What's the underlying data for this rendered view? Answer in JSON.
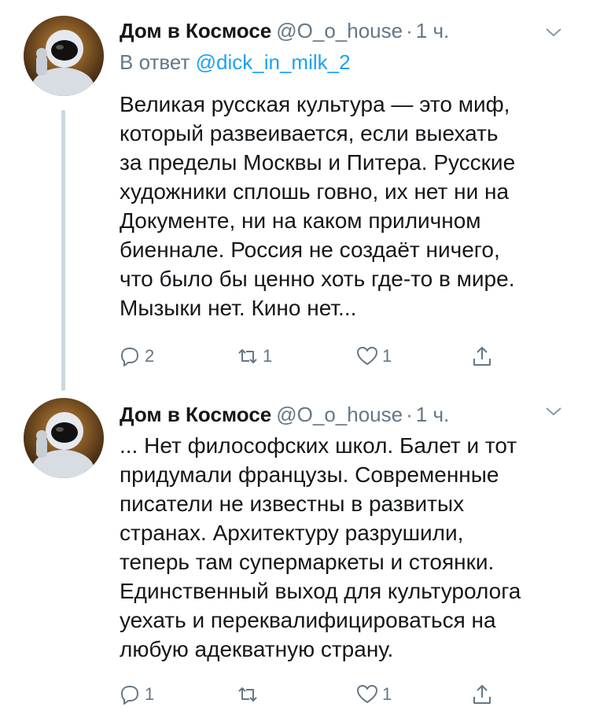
{
  "tweets": [
    {
      "author_name": "Дом в Космосе",
      "handle": "@O_o_house",
      "separator": "·",
      "time": "1 ч.",
      "reply_prefix": "В ответ",
      "reply_to": "@dick_in_milk_2",
      "text": "Великая русская культура — это миф,\nкоторый развеивается, если выехать\nза пределы Москвы и Питера. Русские\nхудожники сплошь говно, их нет ни на\nДокументе, ни на каком приличном\nбиеннале. Россия не создаёт ничего,\nчто было бы ценно хоть где-то в мире.\nМызыки нет. Кино нет...",
      "actions": {
        "replies": "2",
        "retweets": "1",
        "likes": "1"
      }
    },
    {
      "author_name": "Дом в Космосе",
      "handle": "@O_o_house",
      "separator": "·",
      "time": "1 ч.",
      "text": "... Нет философских школ. Балет и тот\nпридумали французы. Современные\nписатели не известны в развитых\nстранах. Архитектуру разрушили,\nтеперь там супермаркеты и стоянки.\nЕдинственный выход для культуролога\nуехать и переквалифицироваться на\nлюбую адекватную страну.",
      "actions": {
        "replies": "1",
        "retweets": "",
        "likes": "1"
      }
    }
  ],
  "icons": {
    "reply": "reply-icon",
    "retweet": "retweet-icon",
    "like": "heart-icon",
    "share": "share-icon",
    "menu": "chevron-down-icon"
  },
  "colors": {
    "text": "#14171a",
    "muted": "#657786",
    "link": "#1da1f2",
    "thread_line": "#ccd6dd"
  }
}
